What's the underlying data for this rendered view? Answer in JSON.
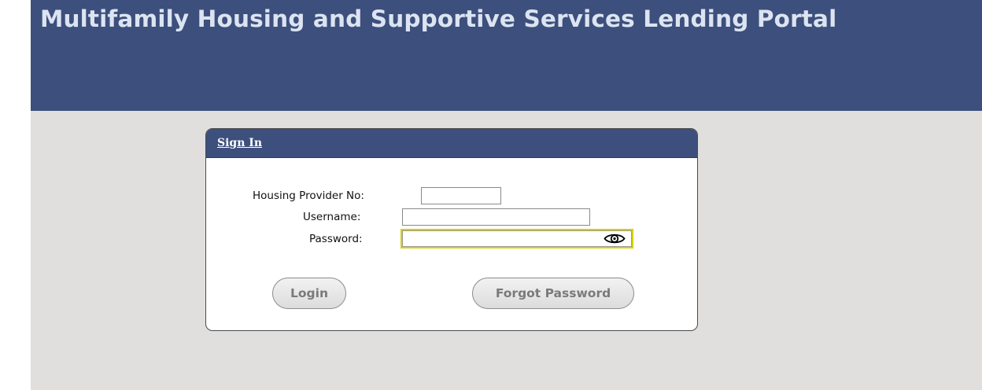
{
  "header": {
    "title": "Multifamily Housing and Supportive Services Lending Portal"
  },
  "signin": {
    "title": "Sign In",
    "fields": {
      "provider_no": {
        "label": "Housing Provider No:",
        "value": ""
      },
      "username": {
        "label": "Username:",
        "value": ""
      },
      "password": {
        "label": "Password:",
        "value": ""
      }
    },
    "buttons": {
      "login": "Login",
      "forgot_password": "Forgot Password"
    }
  },
  "icons": {
    "password_toggle": "eye-icon"
  },
  "colors": {
    "banner": "#3d4f7c",
    "banner_text": "#dce4f2",
    "page_background": "#e0dfdd",
    "focus_outline": "#d7d000",
    "button_text": "#7a7a7a"
  }
}
